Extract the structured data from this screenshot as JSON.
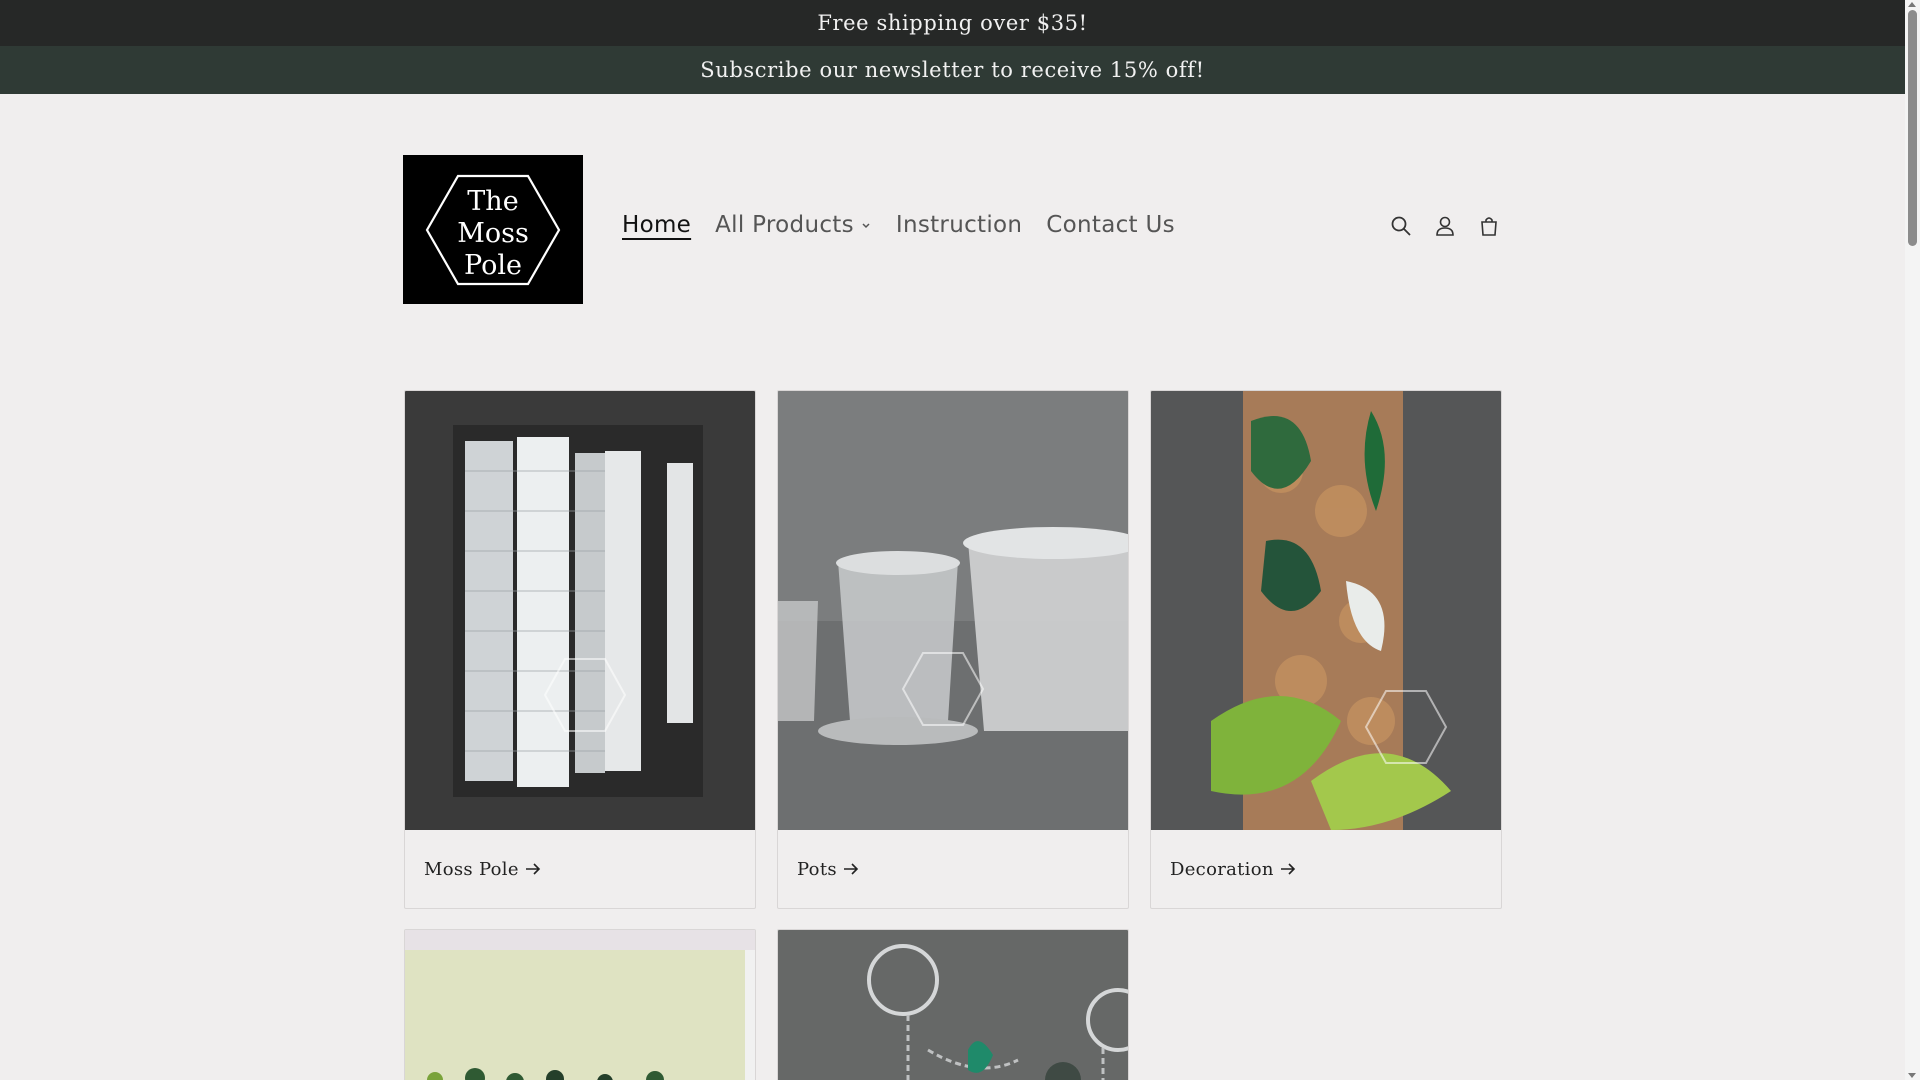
{
  "announcements": [
    "Free shipping over $35!",
    "Subscribe our newsletter to receive 15% off!"
  ],
  "logo": {
    "line1": "The",
    "line2": "Moss",
    "line3": "Pole"
  },
  "nav": [
    {
      "label": "Home"
    },
    {
      "label": "All Products"
    },
    {
      "label": "Instruction"
    },
    {
      "label": "Contact Us"
    }
  ],
  "header_icons": [
    "search-icon",
    "account-icon",
    "cart-icon"
  ],
  "collections": [
    {
      "label": "Moss Pole"
    },
    {
      "label": "Pots"
    },
    {
      "label": "Decoration"
    },
    {
      "label": ""
    },
    {
      "label": ""
    }
  ],
  "colors": {
    "background": "#f0eeee",
    "announcement_bar_1": "#262827",
    "announcement_bar_2": "#2f3a35",
    "logo_bg": "#000000"
  }
}
